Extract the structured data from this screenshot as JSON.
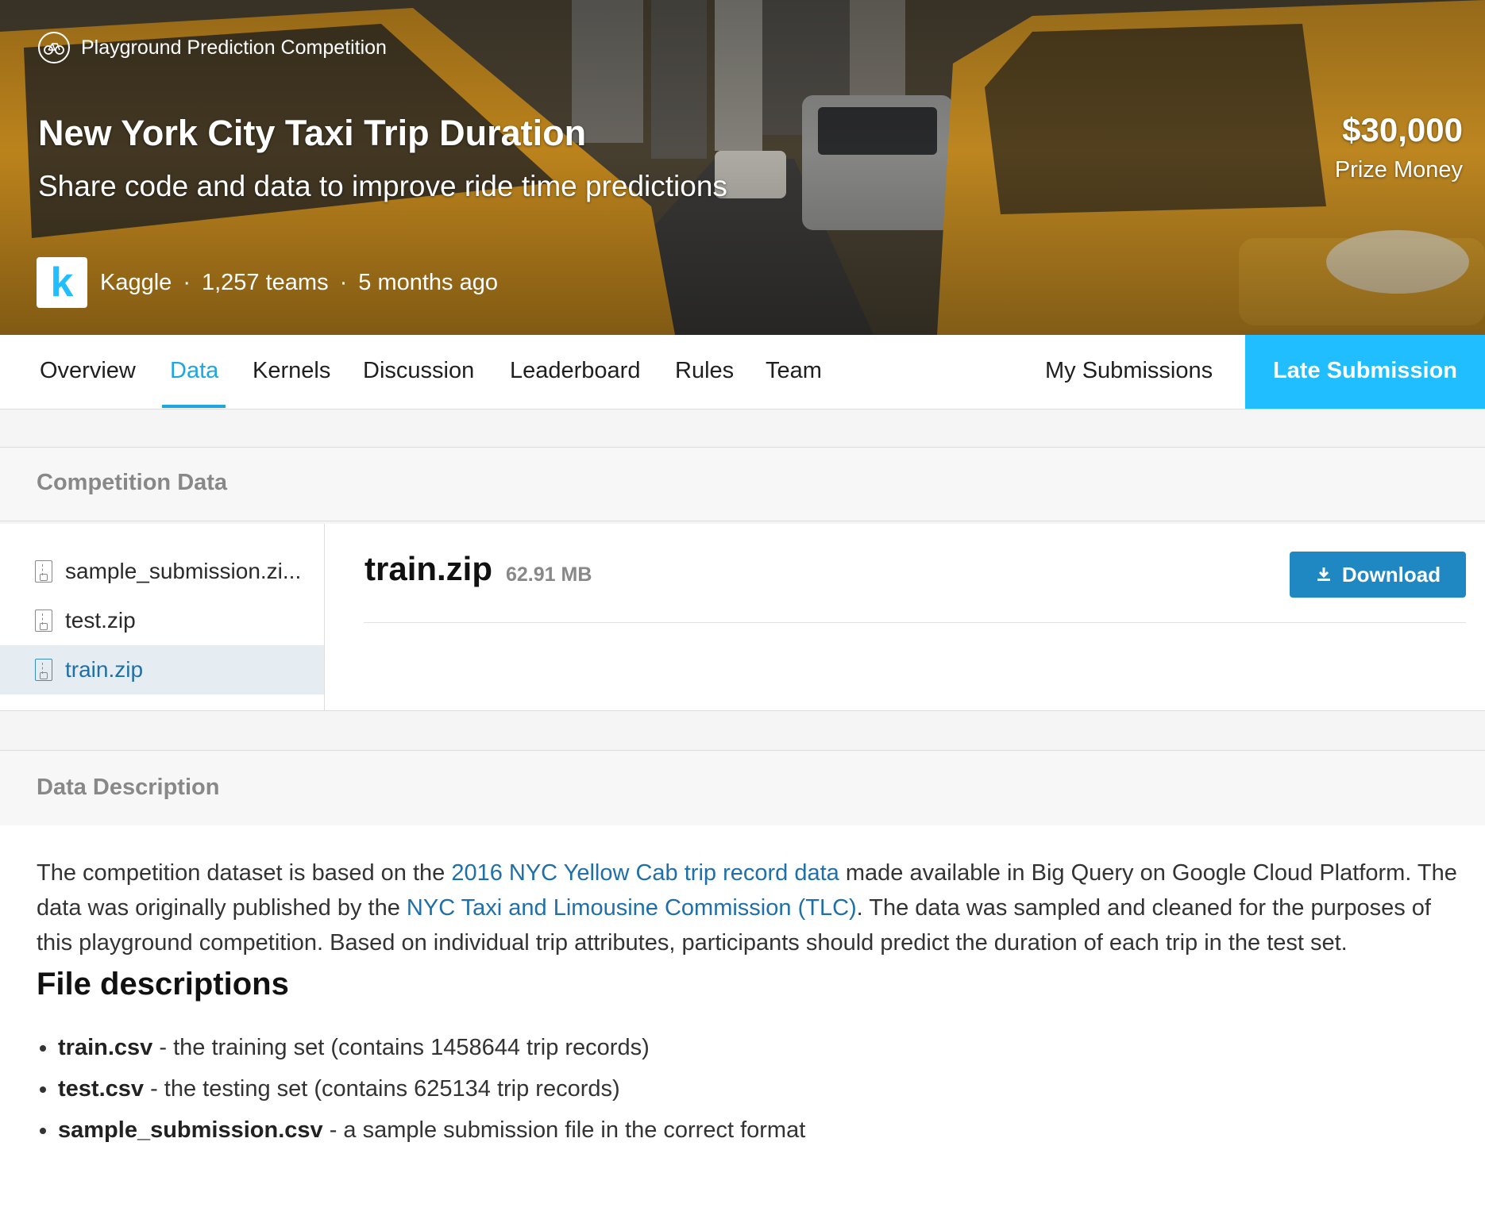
{
  "hero": {
    "kind_label": "Playground Prediction Competition",
    "title": "New York City Taxi Trip Duration",
    "subtitle": "Share code and data to improve ride time predictions",
    "prize_amount": "$30,000",
    "prize_label": "Prize Money",
    "host": "Kaggle",
    "teams": "1,257 teams",
    "age": "5 months ago",
    "separator": "·",
    "logo_letter": "k"
  },
  "tabs": {
    "overview": "Overview",
    "data": "Data",
    "kernels": "Kernels",
    "discussion": "Discussion",
    "leaderboard": "Leaderboard",
    "rules": "Rules",
    "team": "Team",
    "my_submissions": "My Submissions",
    "late_submission": "Late Submission",
    "active": "Data"
  },
  "competition_data": {
    "heading": "Competition Data",
    "files": [
      {
        "name": "sample_submission.zi..."
      },
      {
        "name": "test.zip"
      },
      {
        "name": "train.zip"
      }
    ],
    "selected_file": "train.zip",
    "selected_size": "62.91 MB",
    "download_label": "Download"
  },
  "data_description": {
    "heading": "Data Description",
    "intro_1": "The competition dataset is based on the ",
    "link_1": "2016 NYC Yellow Cab trip record data",
    "intro_2": " made available in Big Query on Google Cloud Platform. The data was originally published by the ",
    "link_2": "NYC Taxi and Limousine Commission (TLC)",
    "intro_3": ". The data was sampled and cleaned for the purposes of this playground competition. Based on individual trip attributes, participants should predict the duration of each trip in the test set.",
    "files_heading": "File descriptions",
    "file_items": [
      {
        "name": "train.csv",
        "desc": " - the training set (contains 1458644 trip records)"
      },
      {
        "name": "test.csv",
        "desc": " - the testing set (contains 625134 trip records)"
      },
      {
        "name": "sample_submission.csv",
        "desc": " - a sample submission file in the correct format"
      }
    ]
  },
  "colors": {
    "accent": "#20beff",
    "link": "#1f6fa8",
    "download": "#1f87c1"
  }
}
